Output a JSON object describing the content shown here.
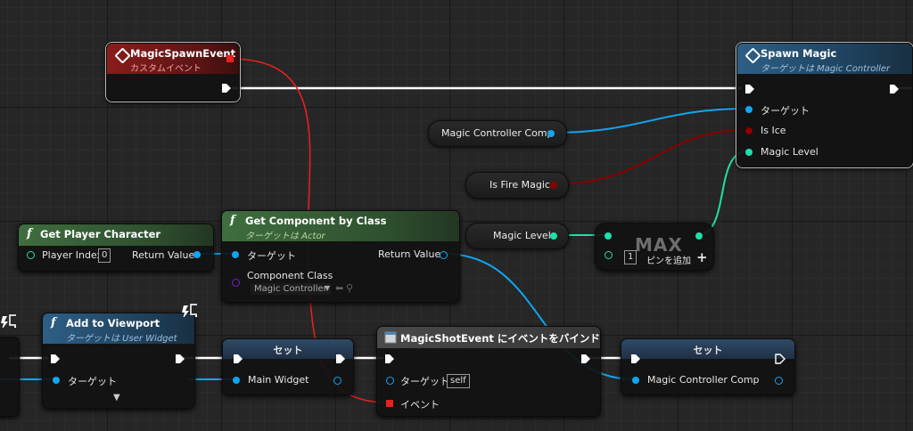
{
  "nodes": {
    "magic_spawn_event": {
      "title": "MagicSpawnEvent",
      "subtitle": "カスタムイベント"
    },
    "spawn_magic": {
      "title": "Spawn Magic",
      "subtitle": "ターゲットは Magic Controller",
      "pins": {
        "target": "ターゲット",
        "is_ice": "Is Ice",
        "magic_level": "Magic Level"
      }
    },
    "get_player_character": {
      "title": "Get Player Character",
      "pins": {
        "player_index": "Player Index",
        "player_index_value": "0",
        "return_value": "Return Value"
      }
    },
    "get_component_by_class": {
      "title": "Get Component by Class",
      "subtitle": "ターゲットは Actor",
      "pins": {
        "target": "ターゲット",
        "component_class": "Component Class",
        "component_class_value": "Magic Controller",
        "return_value": "Return Value"
      }
    },
    "add_to_viewport": {
      "title": "Add to Viewport",
      "subtitle": "ターゲットは User Widget",
      "pins": {
        "target": "ターゲット"
      }
    },
    "set_main_widget": {
      "title": "セット",
      "pins": {
        "main_widget": "Main Widget"
      }
    },
    "bind_event": {
      "title": "MagicShotEvent にイベントをバインド",
      "pins": {
        "target": "ターゲット",
        "target_value": "self",
        "event": "イベント"
      }
    },
    "set_magic_controller": {
      "title": "セット",
      "pins": {
        "magic_controller_comp": "Magic Controller Comp"
      }
    },
    "max": {
      "label": "MAX",
      "input_value": "1",
      "add_pin": "ピンを追加",
      "add_icon": "+"
    }
  },
  "variables": {
    "magic_controller_comp": "Magic Controller Comp",
    "is_fire_magic": "Is Fire Magic",
    "magic_level": "Magic Level"
  },
  "icons": {
    "event": "diamond-icon",
    "function": "function-icon",
    "widget": "widget-icon",
    "monitor": "monitor-icon"
  },
  "colors": {
    "exec_wire": "#ffffff",
    "object_wire": "#12a5f0",
    "bool_wire": "#8a0000",
    "int_wire": "#1de0a8",
    "delegate_wire": "#e82020",
    "event_header": "#8a1c1c",
    "function_header": "#2e5f86",
    "pure_header": "#3f6e3f"
  }
}
